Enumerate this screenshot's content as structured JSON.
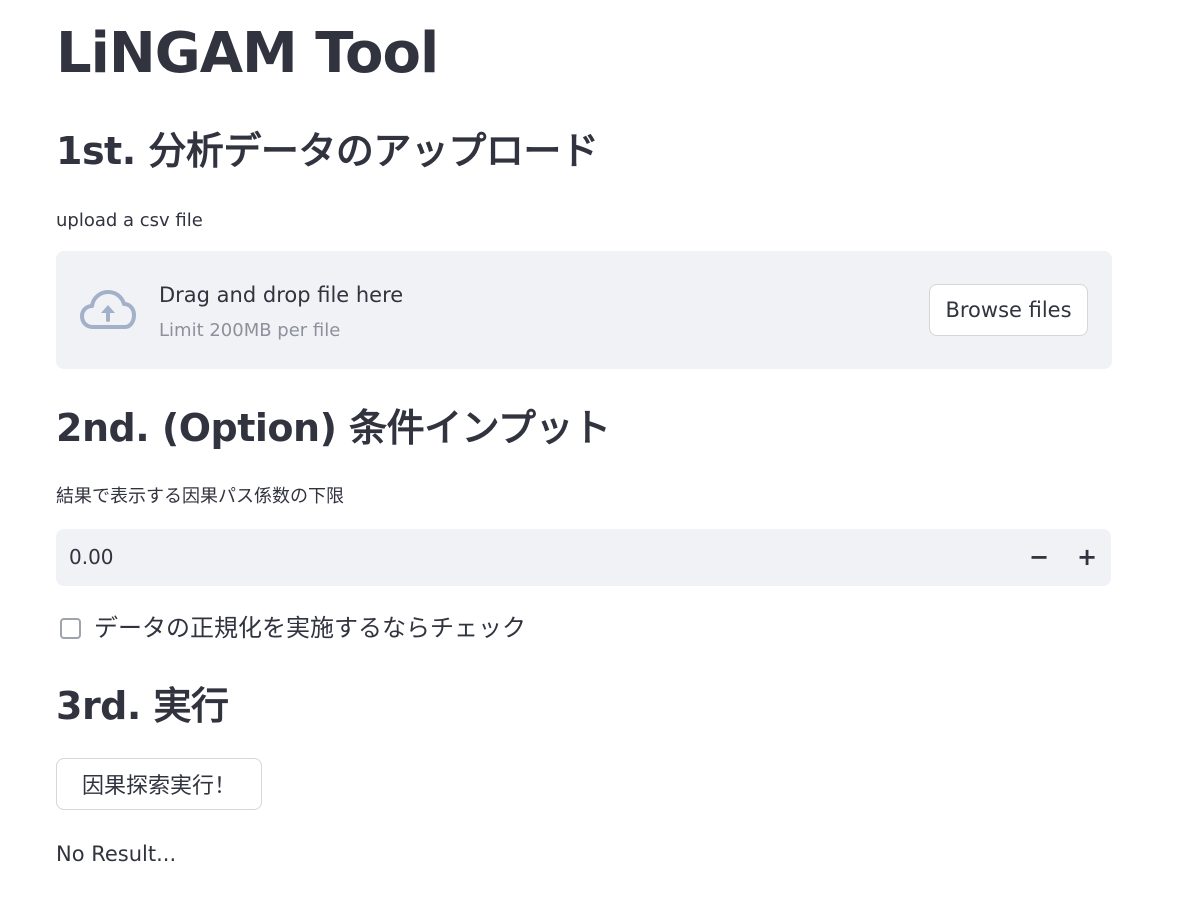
{
  "app": {
    "title": "LiNGAM Tool"
  },
  "sections": {
    "upload": {
      "heading": "1st. 分析データのアップロード",
      "label": "upload a csv file",
      "dropzone_text": "Drag and drop file here",
      "limit_text": "Limit 200MB per file",
      "browse_label": "Browse files",
      "icon": "cloud-upload-icon"
    },
    "options": {
      "heading": "2nd. (Option) 条件インプット",
      "threshold_label": "結果で表示する因果パス係数の下限",
      "threshold_value": "0.00",
      "decrement_label": "−",
      "increment_label": "+",
      "normalize_label": "データの正規化を実施するならチェック",
      "normalize_checked": false
    },
    "run": {
      "heading": "3rd. 実行",
      "button_label": "因果探索実行！",
      "result_text": "No Result..."
    }
  },
  "colors": {
    "text": "#31333f",
    "widget_bg": "#f0f2f6",
    "muted": "#8c919b",
    "icon": "#a3b0c9",
    "border": "#d6d6d9"
  }
}
